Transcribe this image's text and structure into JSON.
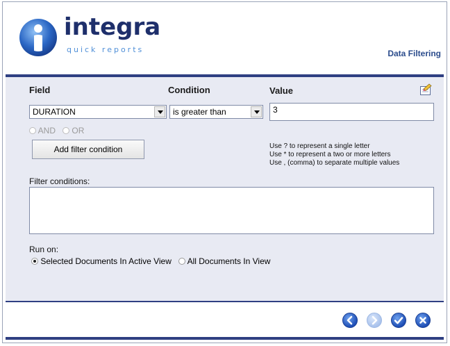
{
  "header": {
    "logo_text": "integra",
    "logo_subtext": "quick reports",
    "section_title": "Data Filtering"
  },
  "form": {
    "field_label": "Field",
    "condition_label": "Condition",
    "value_label": "Value",
    "field_value": "DURATION",
    "condition_value": "is greater than",
    "value_input": "3",
    "and_label": "AND",
    "or_label": "OR",
    "add_button_label": "Add filter condition",
    "hints": [
      "Use ? to represent a single letter",
      "Use * to represent a two or more letters",
      "Use , (comma) to separate multiple values"
    ],
    "filter_conditions_label": "Filter conditions:",
    "filter_conditions_value": "",
    "run_on_label": "Run on:",
    "run_options": [
      {
        "label": "Selected Documents In Active View",
        "checked": true
      },
      {
        "label": "All Documents In View",
        "checked": false
      }
    ]
  },
  "icons": {
    "edit": "edit-note-icon",
    "back": "back-icon",
    "forward": "forward-icon",
    "ok": "check-icon",
    "cancel": "cancel-icon"
  },
  "colors": {
    "brand_dark": "#1e2f6b",
    "brand_light": "#4f8fd8",
    "rule": "#2f3f82",
    "panel_bg": "#e8eaf3",
    "nav_blue": "#1e4eb5"
  }
}
